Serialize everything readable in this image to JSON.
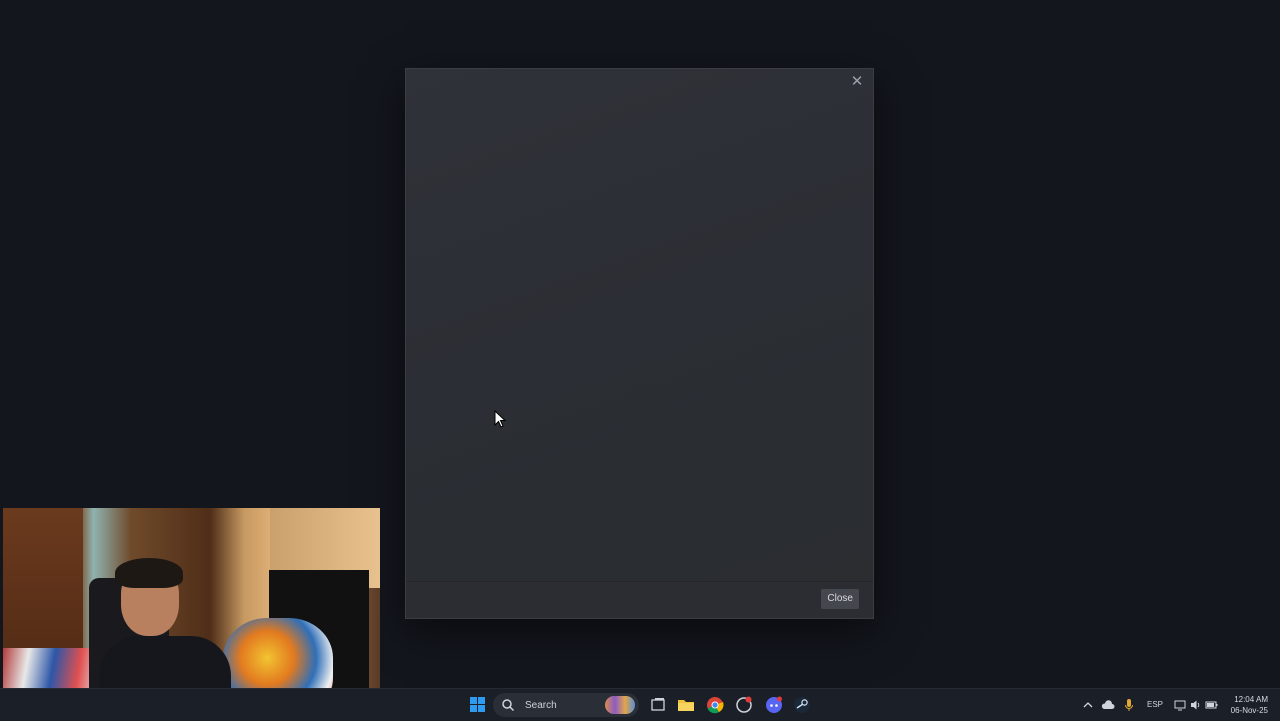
{
  "dialog": {
    "close_x": "✕",
    "close_button_label": "Close"
  },
  "taskbar": {
    "search_label": "Search",
    "language": "ESP",
    "time": "12:04 AM",
    "date": "06-Nov-25"
  },
  "colors": {
    "desktop_bg": "#13161d",
    "dialog_bg": "#2d3035",
    "taskbar_bg": "#1b1f27",
    "accent_blue": "#2f9bf0"
  }
}
